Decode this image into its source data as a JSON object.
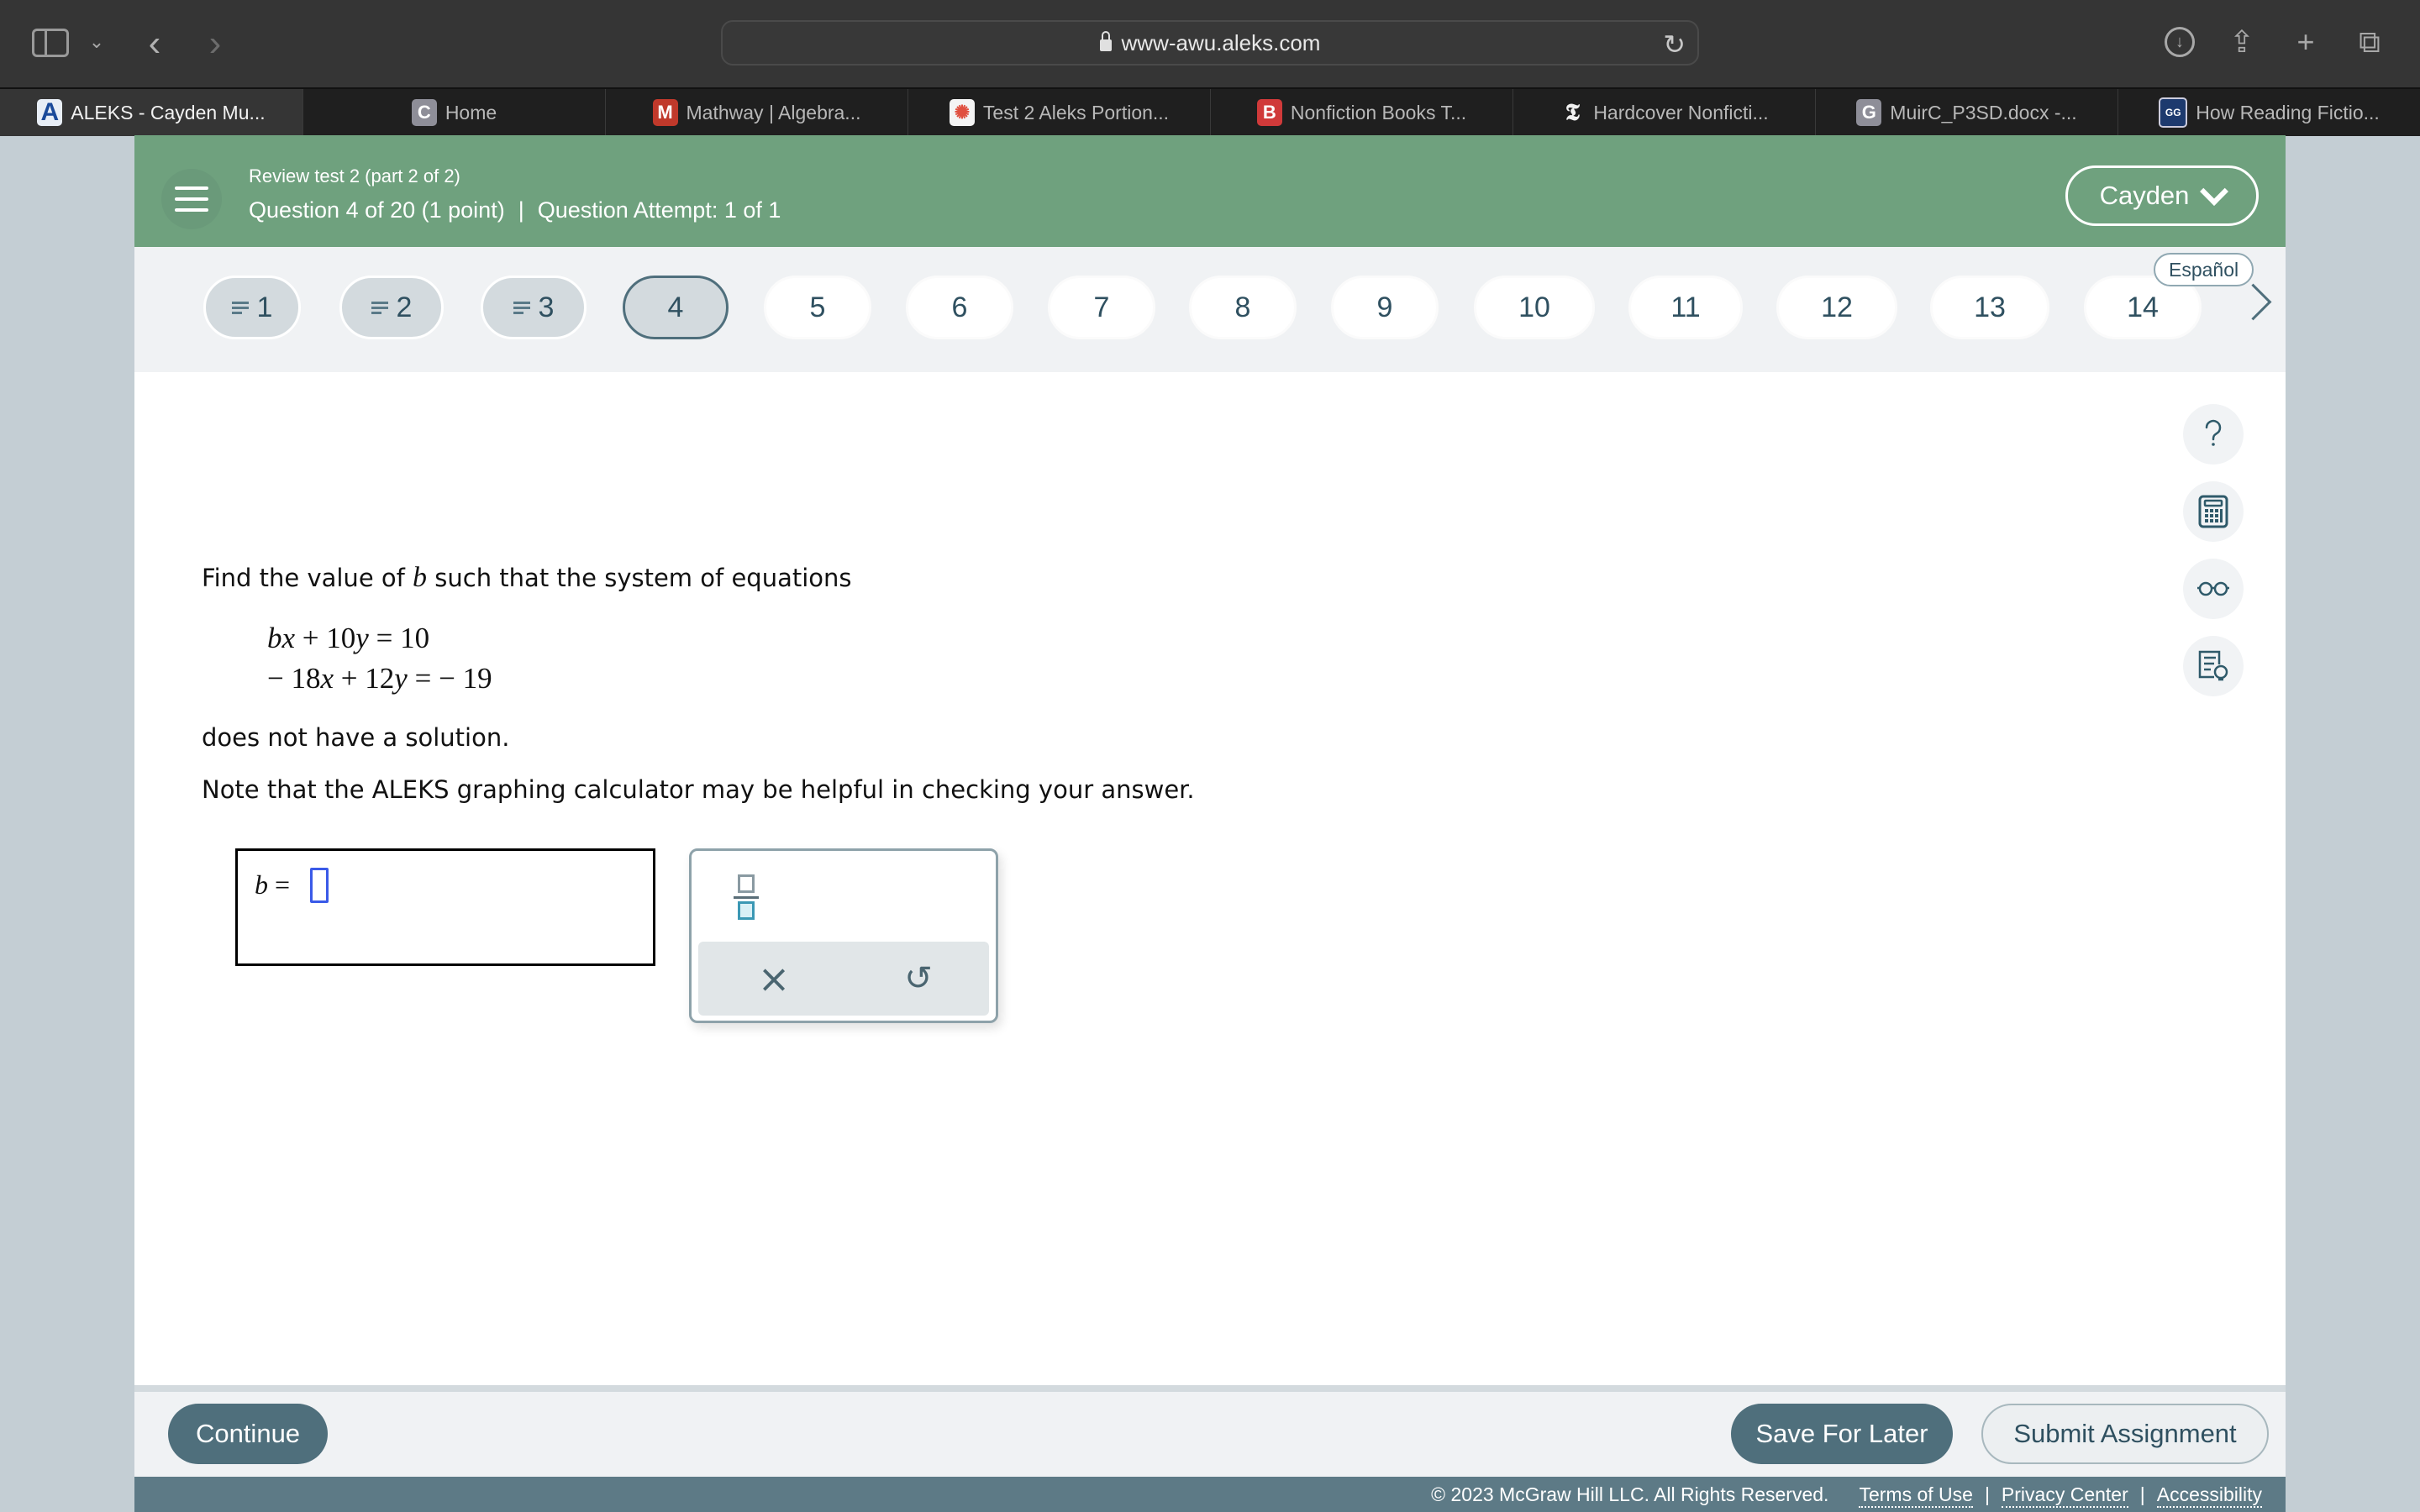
{
  "browser": {
    "url": "www-awu.aleks.com",
    "tabs": [
      {
        "label": "ALEKS - Cayden Mu...",
        "favicon": "A",
        "favicon_color": "#1a4a9a",
        "active": true
      },
      {
        "label": "Home",
        "favicon": "C",
        "favicon_color": "#8e8e98",
        "active": false
      },
      {
        "label": "Mathway | Algebra...",
        "favicon": "M",
        "favicon_color": "#c0392b",
        "active": false
      },
      {
        "label": "Test 2 Aleks Portion...",
        "favicon": "✺",
        "favicon_color": "#e05040",
        "active": false
      },
      {
        "label": "Nonfiction Books T...",
        "favicon": "B",
        "favicon_color": "#d03a3a",
        "active": false
      },
      {
        "label": "Hardcover Nonficti...",
        "favicon": "𝕿",
        "favicon_color": "#1f1f1f",
        "active": false
      },
      {
        "label": "MuirC_P3SD.docx -...",
        "favicon": "G",
        "favicon_color": "#8e8e98",
        "active": false
      },
      {
        "label": "How Reading Fictio...",
        "favicon": "GG",
        "favicon_color": "#1d3a6e",
        "active": false
      }
    ]
  },
  "header": {
    "subtitle": "Review test 2 (part 2 of 2)",
    "question_info": "Question 4 of 20 (1 point)",
    "separator": "|",
    "attempt_info": "Question Attempt: 1 of 1",
    "user_name": "Cayden",
    "accent_color": "#6fa17e"
  },
  "question_nav": {
    "language_button": "Español",
    "current": 4,
    "pills": [
      {
        "label": "1",
        "status": "answered"
      },
      {
        "label": "2",
        "status": "answered"
      },
      {
        "label": "3",
        "status": "answered"
      },
      {
        "label": "4",
        "status": "current"
      },
      {
        "label": "5",
        "status": "unanswered"
      },
      {
        "label": "6",
        "status": "unanswered"
      },
      {
        "label": "7",
        "status": "unanswered"
      },
      {
        "label": "8",
        "status": "unanswered"
      },
      {
        "label": "9",
        "status": "unanswered"
      },
      {
        "label": "10",
        "status": "unanswered"
      },
      {
        "label": "11",
        "status": "unanswered"
      },
      {
        "label": "12",
        "status": "unanswered"
      },
      {
        "label": "13",
        "status": "unanswered"
      },
      {
        "label": "14",
        "status": "unanswered"
      }
    ]
  },
  "question": {
    "prompt_before": "Find the value of ",
    "variable": "b",
    "prompt_after": " such that the system of equations",
    "equation_1": "bx + 10y = 10",
    "equation_2": "− 18x + 12y = − 19",
    "condition": "does not have a solution.",
    "note": "Note that the ALEKS graphing calculator may be helpful in checking your answer."
  },
  "answer": {
    "label": "b =",
    "value": ""
  },
  "tool_panel": {
    "fraction_tool": "fraction-icon",
    "clear_label": "×",
    "undo_label": "↺"
  },
  "side_tools": [
    "help-icon",
    "calculator-icon",
    "glasses-icon",
    "notes-hint-icon"
  ],
  "footer": {
    "continue_label": "Continue",
    "save_label": "Save For Later",
    "submit_label": "Submit Assignment",
    "copyright": "© 2023 McGraw Hill LLC. All Rights Reserved.",
    "links": [
      "Terms of Use",
      "Privacy Center",
      "Accessibility"
    ],
    "link_separator": "|"
  }
}
